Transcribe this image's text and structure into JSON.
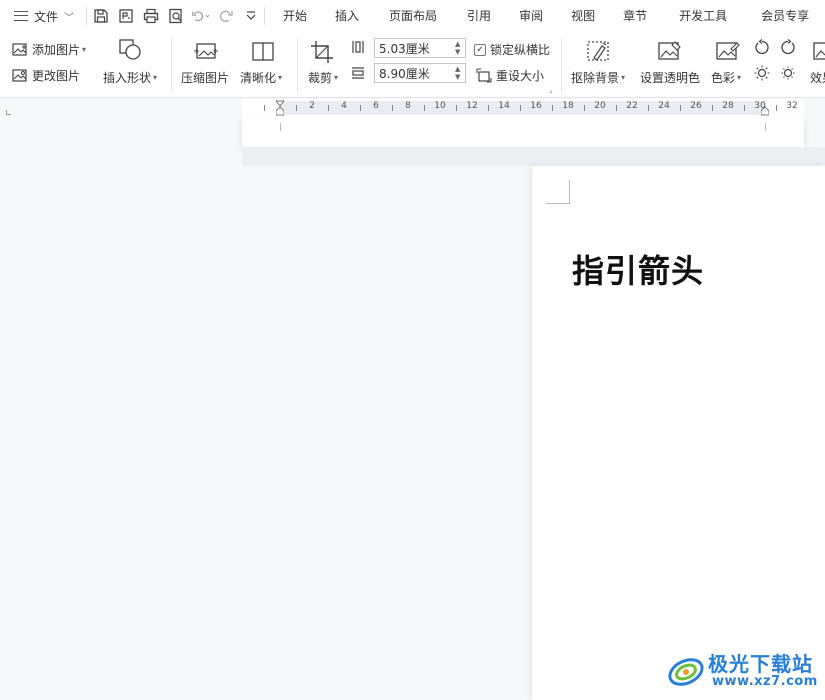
{
  "menubar": {
    "file_label": "文件",
    "tabs": [
      "开始",
      "插入",
      "页面布局",
      "引用",
      "审阅",
      "视图",
      "章节",
      "开发工具",
      "会员专享"
    ]
  },
  "ribbon": {
    "add_picture": "添加图片",
    "change_picture": "更改图片",
    "insert_shape": "插入形状",
    "compress_picture": "压缩图片",
    "sharpen": "清晰化",
    "crop": "裁剪",
    "height_value": "5.03厘米",
    "width_value": "8.90厘米",
    "lock_ratio": "锁定纵横比",
    "lock_ratio_checked": true,
    "reset_size": "重设大小",
    "remove_background": "抠除背景",
    "set_transparent": "设置透明色",
    "color": "色彩",
    "effects": "效果"
  },
  "ruler": {
    "labels": [
      "2",
      "4",
      "6",
      "8",
      "10",
      "12",
      "14",
      "16",
      "18",
      "20",
      "22",
      "24",
      "26",
      "28",
      "30",
      "32"
    ]
  },
  "document": {
    "title": "指引箭头"
  },
  "watermark": {
    "name": "极光下载站",
    "url": "www.xz7.com"
  }
}
